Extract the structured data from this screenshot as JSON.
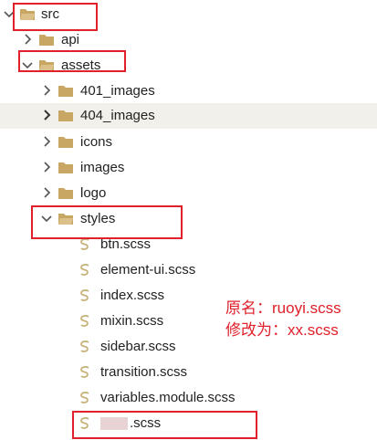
{
  "explorer": {
    "items": [
      {
        "label": "src"
      },
      {
        "label": "api"
      },
      {
        "label": "assets"
      },
      {
        "label": "401_images"
      },
      {
        "label": "404_images"
      },
      {
        "label": "icons"
      },
      {
        "label": "images"
      },
      {
        "label": "logo"
      },
      {
        "label": "styles"
      },
      {
        "label": "btn.scss"
      },
      {
        "label": "element-ui.scss"
      },
      {
        "label": "index.scss"
      },
      {
        "label": "mixin.scss"
      },
      {
        "label": "sidebar.scss"
      },
      {
        "label": "transition.scss"
      },
      {
        "label": "variables.module.scss"
      },
      {
        "label": ".scss"
      }
    ]
  },
  "annotation": {
    "line1": "原名：ruoyi.scss",
    "line2": "修改为：xx.scss"
  },
  "colors": {
    "folder": "#c8a765",
    "sass": "#c7b47a",
    "highlight": "#e0202a",
    "hover_row": "#f2f0eb"
  }
}
